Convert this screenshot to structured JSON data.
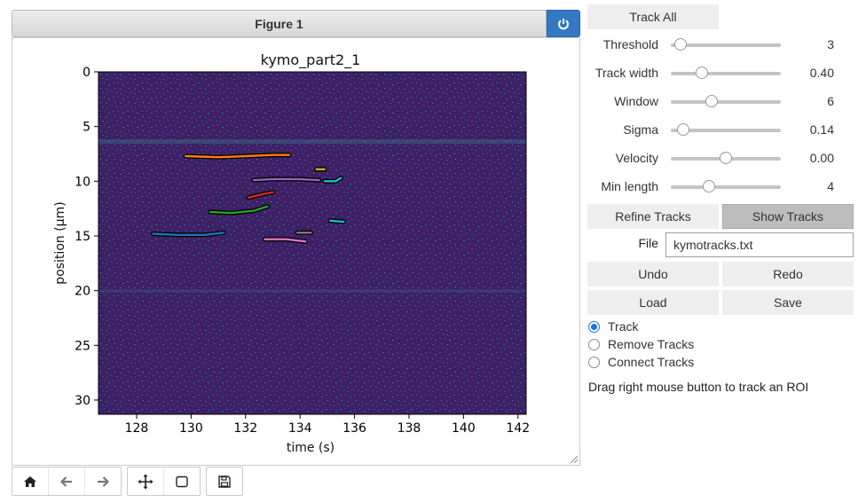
{
  "figure": {
    "header_title": "Figure 1",
    "power_icon": "power-icon"
  },
  "plot": {
    "title": "kymo_part2_1",
    "xlabel": "time (s)",
    "ylabel": "position (μm)",
    "xticks": [
      "128",
      "130",
      "132",
      "134",
      "136",
      "138",
      "140",
      "142"
    ],
    "yticks": [
      "0",
      "5",
      "10",
      "15",
      "20",
      "25",
      "30"
    ]
  },
  "chart_data": {
    "type": "heatmap",
    "title": "kymo_part2_1",
    "xlabel": "time (s)",
    "ylabel": "position (μm)",
    "xlim": [
      126.6,
      142.3
    ],
    "ylim": [
      31.3,
      0
    ],
    "tracks": [
      {
        "color": "#ff7f0e",
        "x": [
          129.8,
          131.0,
          132.0,
          133.0,
          133.6
        ],
        "y": [
          7.7,
          7.8,
          7.7,
          7.6,
          7.6
        ]
      },
      {
        "color": "#9467bd",
        "x": [
          132.3,
          133.0,
          134.0,
          134.7
        ],
        "y": [
          9.9,
          9.8,
          9.8,
          9.9
        ]
      },
      {
        "color": "#17becf",
        "x": [
          134.9,
          135.3,
          135.5
        ],
        "y": [
          10.0,
          10.0,
          9.7
        ]
      },
      {
        "color": "#d62728",
        "x": [
          132.1,
          132.6,
          133.0
        ],
        "y": [
          11.5,
          11.2,
          11.0
        ]
      },
      {
        "color": "#2ca02c",
        "x": [
          130.7,
          131.5,
          132.3,
          132.8
        ],
        "y": [
          12.8,
          12.9,
          12.7,
          12.3
        ]
      },
      {
        "color": "#1f77b4",
        "x": [
          128.6,
          129.5,
          130.5,
          131.2
        ],
        "y": [
          14.8,
          14.9,
          14.9,
          14.7
        ]
      },
      {
        "color": "#e377c2",
        "x": [
          132.7,
          133.5,
          134.2
        ],
        "y": [
          15.3,
          15.3,
          15.5
        ]
      },
      {
        "color": "#7f7f7f",
        "x": [
          133.9,
          134.4
        ],
        "y": [
          14.7,
          14.7
        ]
      },
      {
        "color": "#bcbd22",
        "x": [
          134.6,
          134.9
        ],
        "y": [
          8.9,
          8.9
        ]
      },
      {
        "color": "#17becf",
        "x": [
          135.1,
          135.6
        ],
        "y": [
          13.6,
          13.7
        ]
      }
    ]
  },
  "toolbar": {
    "buttons": [
      "home-icon",
      "back-arrow-icon",
      "forward-arrow-icon",
      "move-icon",
      "zoom-rect-icon",
      "save-icon"
    ]
  },
  "controls": {
    "track_all": "Track All",
    "sliders": [
      {
        "label": "Threshold",
        "value": "3",
        "fraction": 0.09
      },
      {
        "label": "Track width",
        "value": "0.40",
        "fraction": 0.28
      },
      {
        "label": "Window",
        "value": "6",
        "fraction": 0.37
      },
      {
        "label": "Sigma",
        "value": "0.14",
        "fraction": 0.11
      },
      {
        "label": "Velocity",
        "value": "0.00",
        "fraction": 0.5
      },
      {
        "label": "Min length",
        "value": "4",
        "fraction": 0.35
      }
    ],
    "refine_tracks": "Refine Tracks",
    "show_tracks": "Show Tracks",
    "file_label": "File",
    "file_value": "kymotracks.txt",
    "undo": "Undo",
    "redo": "Redo",
    "load": "Load",
    "save": "Save",
    "radios": [
      {
        "label": "Track",
        "checked": true
      },
      {
        "label": "Remove Tracks",
        "checked": false
      },
      {
        "label": "Connect Tracks",
        "checked": false
      }
    ],
    "hint": "Drag right mouse button to track an ROI"
  },
  "colors": {
    "accent": "#3479c4",
    "heatmap_background": "#3e1f66",
    "radio_selected": "#1a73e8"
  }
}
